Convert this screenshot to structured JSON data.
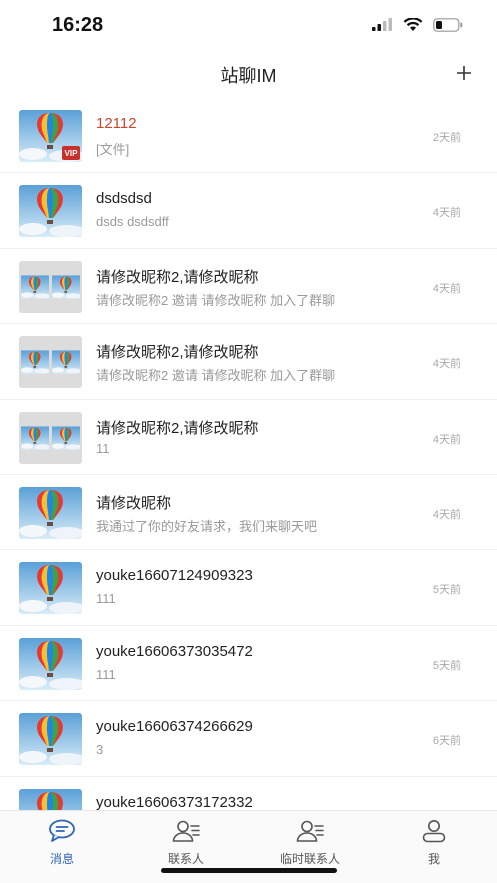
{
  "status": {
    "time": "16:28"
  },
  "nav": {
    "title": "站聊IM"
  },
  "conversations": [
    {
      "title": "12112",
      "subtitle": "[文件]",
      "time": "2天前",
      "avatar": "balloon",
      "vip": true,
      "title_color": "#d0452f"
    },
    {
      "title": "dsdsdsd",
      "subtitle": "dsds dsdsdff",
      "time": "4天前",
      "avatar": "balloon"
    },
    {
      "title": "请修改昵称2,请修改昵称",
      "subtitle": "请修改昵称2 邀请 请修改昵称 加入了群聊",
      "time": "4天前",
      "avatar": "group"
    },
    {
      "title": "请修改昵称2,请修改昵称",
      "subtitle": "请修改昵称2 邀请 请修改昵称 加入了群聊",
      "time": "4天前",
      "avatar": "group"
    },
    {
      "title": "请修改昵称2,请修改昵称",
      "subtitle": "11",
      "time": "4天前",
      "avatar": "group"
    },
    {
      "title": "请修改昵称",
      "subtitle": "我通过了你的好友请求，我们来聊天吧",
      "time": "4天前",
      "avatar": "balloon"
    },
    {
      "title": "youke16607124909323",
      "subtitle": "111",
      "time": "5天前",
      "avatar": "balloon"
    },
    {
      "title": "youke16606373035472",
      "subtitle": "111",
      "time": "5天前",
      "avatar": "balloon"
    },
    {
      "title": "youke16606374266629",
      "subtitle": "3",
      "time": "6天前",
      "avatar": "balloon"
    },
    {
      "title": "youke16606373172332",
      "subtitle": "",
      "time": "",
      "avatar": "balloon"
    }
  ],
  "vip_label": "VIP",
  "tabs": [
    {
      "label": "消息",
      "icon": "message-icon",
      "active": true
    },
    {
      "label": "联系人",
      "icon": "contacts-icon",
      "active": false
    },
    {
      "label": "临时联系人",
      "icon": "temp-contacts-icon",
      "active": false
    },
    {
      "label": "我",
      "icon": "profile-icon",
      "active": false
    }
  ],
  "colors": {
    "accent": "#2e64b8",
    "unread_title": "#d0452f"
  }
}
